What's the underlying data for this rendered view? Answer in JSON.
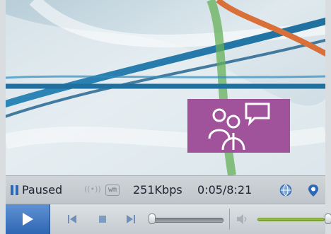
{
  "status": {
    "state": "Paused",
    "signal_icon": "((•))",
    "format_badge": "wm",
    "bitrate": "251Kbps",
    "time": "0:05/8:21"
  },
  "icons": {
    "pause_indicator": "pause-bars-icon",
    "globe": "globe-icon",
    "pin": "location-pin-icon",
    "play": "play-icon",
    "previous": "skip-previous-icon",
    "stop": "stop-icon",
    "next": "skip-next-icon",
    "speaker": "speaker-icon"
  },
  "playback": {
    "position_fraction": 0.01,
    "volume_fraction": 1.0
  },
  "colors": {
    "accent_blue": "#2f66b3",
    "volume_green": "#8dbb3a",
    "presenter_purple": "#a0529a"
  }
}
